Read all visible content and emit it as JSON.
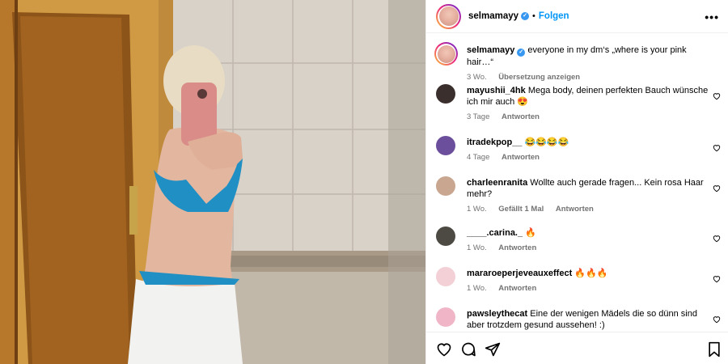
{
  "post": {
    "author": "selmamayy",
    "follow_label": "Folgen",
    "dot": "•",
    "more_label": "•••",
    "caption": "everyone in my dm‘s „where is your pink hair…“",
    "caption_age": "3 Wo.",
    "translate_label": "Übersetzung anzeigen"
  },
  "comments": [
    {
      "user": "mayushii_4hk",
      "text": "Mega body, deinen perfekten Bauch wünsche ich mir auch 😍",
      "age": "3 Tage",
      "likes": "",
      "reply": "Antworten",
      "avatar_color": "#3a2f2c"
    },
    {
      "user": "itradekpop__",
      "text": "😂😂😂😂",
      "age": "4 Tage",
      "likes": "",
      "reply": "Antworten",
      "avatar_color": "#6b4f9c"
    },
    {
      "user": "charleenranita",
      "text": "Wollte auch gerade fragen... Kein rosa Haar mehr?",
      "age": "1 Wo.",
      "likes": "Gefällt 1 Mal",
      "reply": "Antworten",
      "avatar_color": "#c8a68f"
    },
    {
      "user": "____.carina._",
      "text": "🔥",
      "age": "1 Wo.",
      "likes": "",
      "reply": "Antworten",
      "avatar_color": "#4d4a44"
    },
    {
      "user": "mararoeperjeveauxeffect",
      "text": "🔥🔥🔥",
      "age": "1 Wo.",
      "likes": "",
      "reply": "Antworten",
      "avatar_color": "#f3cfd6"
    },
    {
      "user": "pawsleythecat",
      "text": "Eine der wenigen Mädels die so dünn sind aber trotzdem gesund aussehen! :)",
      "age": "",
      "likes": "",
      "reply": "",
      "avatar_color": "#f0b6c8"
    }
  ],
  "icons": {
    "heart": "heart-icon",
    "comment": "comment-icon",
    "share": "share-icon",
    "save": "bookmark-icon",
    "verified": "verified-badge-icon",
    "more": "more-options-icon"
  },
  "colors": {
    "accent": "#0095f6",
    "verified": "#3897f0",
    "muted": "#737373",
    "divider": "#efefef"
  }
}
